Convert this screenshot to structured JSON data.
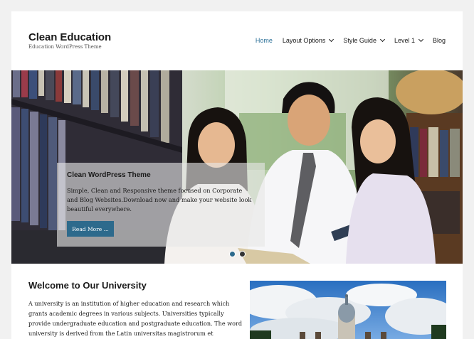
{
  "site": {
    "title": "Clean Education",
    "description": "Education WordPress Theme"
  },
  "nav": {
    "items": [
      {
        "label": "Home",
        "active": true,
        "has_dropdown": false
      },
      {
        "label": "Layout Options",
        "has_dropdown": true
      },
      {
        "label": "Style Guide",
        "has_dropdown": true
      },
      {
        "label": "Level 1",
        "has_dropdown": true
      },
      {
        "label": "Blog",
        "has_dropdown": false
      }
    ]
  },
  "slider": {
    "title": "Clean WordPress Theme",
    "text": "Simple, Clean and Responsive theme focused on Corporate and Blog Websites.Download now and make your website look beautiful everywhere.",
    "button_label": "Read More ...",
    "dot_count": 2,
    "active_dot": 1
  },
  "content": {
    "heading": "Welcome to Our University",
    "text": "A university is an institution of higher education and research which grants academic degrees in various subjects. Universities typically provide undergraduate education and postgraduate education. The word university is derived from the Latin universitas magistrorum et scholarium, which"
  },
  "colors": {
    "accent": "#2d6a8c",
    "nav_active": "#2a6f97",
    "background": "#f1f1f1"
  }
}
